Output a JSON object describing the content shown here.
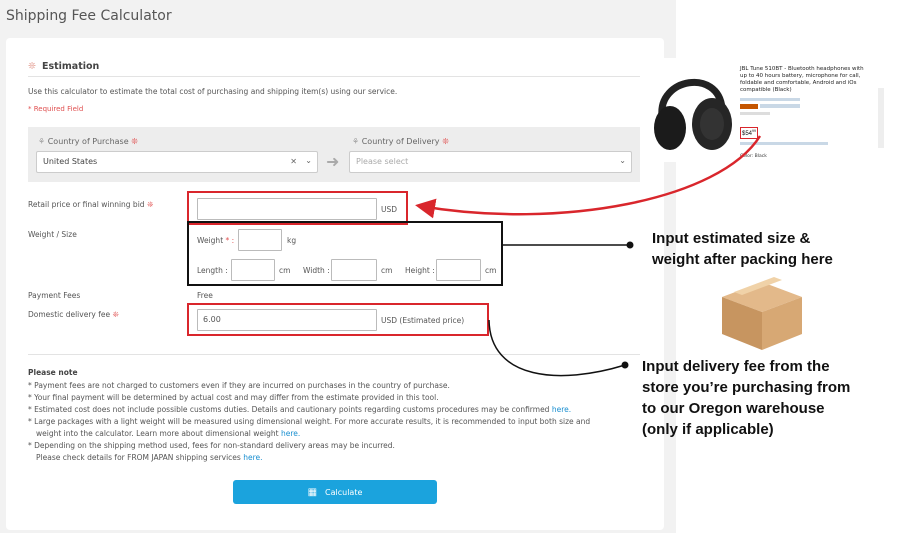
{
  "page_title": "Shipping Fee Calculator",
  "estimation": {
    "heading": "Estimation",
    "intro": "Use this calculator to estimate the total cost of purchasing and shipping item(s) using our service.",
    "required_note": "* Required Field",
    "country_purchase_label": "Country of Purchase",
    "country_purchase_value": "United States",
    "country_delivery_label": "Country of Delivery",
    "country_delivery_placeholder": "Please select",
    "required_mark": "❊",
    "retail_label": "Retail price or final winning bid",
    "retail_unit": "USD",
    "weight_size_label": "Weight / Size",
    "weight_label": "Weight",
    "weight_star": "* :",
    "weight_unit": "kg",
    "length_label": "Length :",
    "width_label": "Width :",
    "height_label": "Height :",
    "dim_unit": "cm",
    "payment_fees_label": "Payment Fees",
    "payment_fees_value": "Free",
    "domestic_label": "Domestic delivery fee",
    "domestic_value": "6.00",
    "domestic_unit": "USD (Estimated price)"
  },
  "notes": {
    "heading": "Please note",
    "line1": "* Payment fees are not charged to customers even if they are incurred on purchases in the country of purchase.",
    "line2": "* Your final payment will be determined by actual cost and may differ from the estimate provided in this tool.",
    "line3": "* Estimated cost does not include possible customs duties. Details and cautionary points regarding customs procedures may be confirmed",
    "line4": "* Large packages with a light weight will be measured using dimensional weight. For more accurate results, it is recommended to input both size and",
    "line5": "weight into the calculator. Learn more about dimensional weight",
    "line6": "* Depending on the shipping method used, fees for non-standard delivery areas may be incurred.",
    "line7": "Please check details for FROM JAPAN shipping services",
    "here": "here."
  },
  "calculate_label": "Calculate",
  "annotations": {
    "size_weight": "Input estimated size & weight after packing here",
    "size_weight_l1": "Input estimated size &",
    "size_weight_l2": "weight after packing here",
    "delivery_l1": "Input delivery fee from the",
    "delivery_l2": "store you’re purchasing from",
    "delivery_l3": "to our Oregon warehouse",
    "delivery_l4": "(only if applicable)"
  },
  "product": {
    "title_l1": "JBL Tune 510BT - Bluetooth headphones with",
    "title_l2": "up to 40 hours battery, microphone for call,",
    "title_l3": "foldable and comfortable, Android and iOs",
    "title_l4": "compatible (Black)",
    "price": "$54",
    "cents": "99",
    "color_label": "Color:",
    "color_value": "Black"
  },
  "colors": {
    "accent": "#1ba3dd",
    "annotation_red": "#d9262c",
    "required": "#e05050"
  }
}
